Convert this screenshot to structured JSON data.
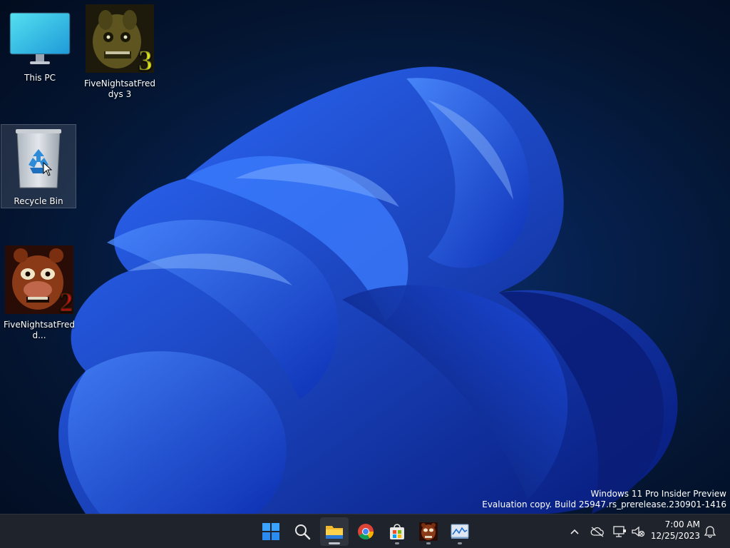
{
  "desktop": {
    "icons": [
      {
        "label": "This PC"
      },
      {
        "label": "FiveNightsatFreddys 3",
        "badge": "3"
      },
      {
        "label": "Recycle Bin"
      },
      {
        "label": "FiveNightsatFredd...",
        "badge": "2"
      }
    ]
  },
  "watermark": {
    "line1": "Windows 11 Pro Insider Preview",
    "line2": "Evaluation copy. Build 25947.rs_prerelease.230901-1416"
  },
  "taskbar": {
    "apps": [
      "start-icon",
      "search-icon",
      "file-explorer-icon",
      "chrome-icon",
      "microsoft-store-icon",
      "fnaf-icon",
      "monitor-app-icon"
    ],
    "tray": [
      "chevron-up-icon",
      "onedrive-icon",
      "network-icon",
      "volume-muted-icon",
      "notification-bell-icon"
    ],
    "clock": {
      "time": "7:00 AM",
      "date": "12/25/2023"
    }
  },
  "colors": {
    "accent": "#0a5fd8",
    "taskbar_bg": "#1f232c",
    "wallpaper_dark": "#041633"
  }
}
